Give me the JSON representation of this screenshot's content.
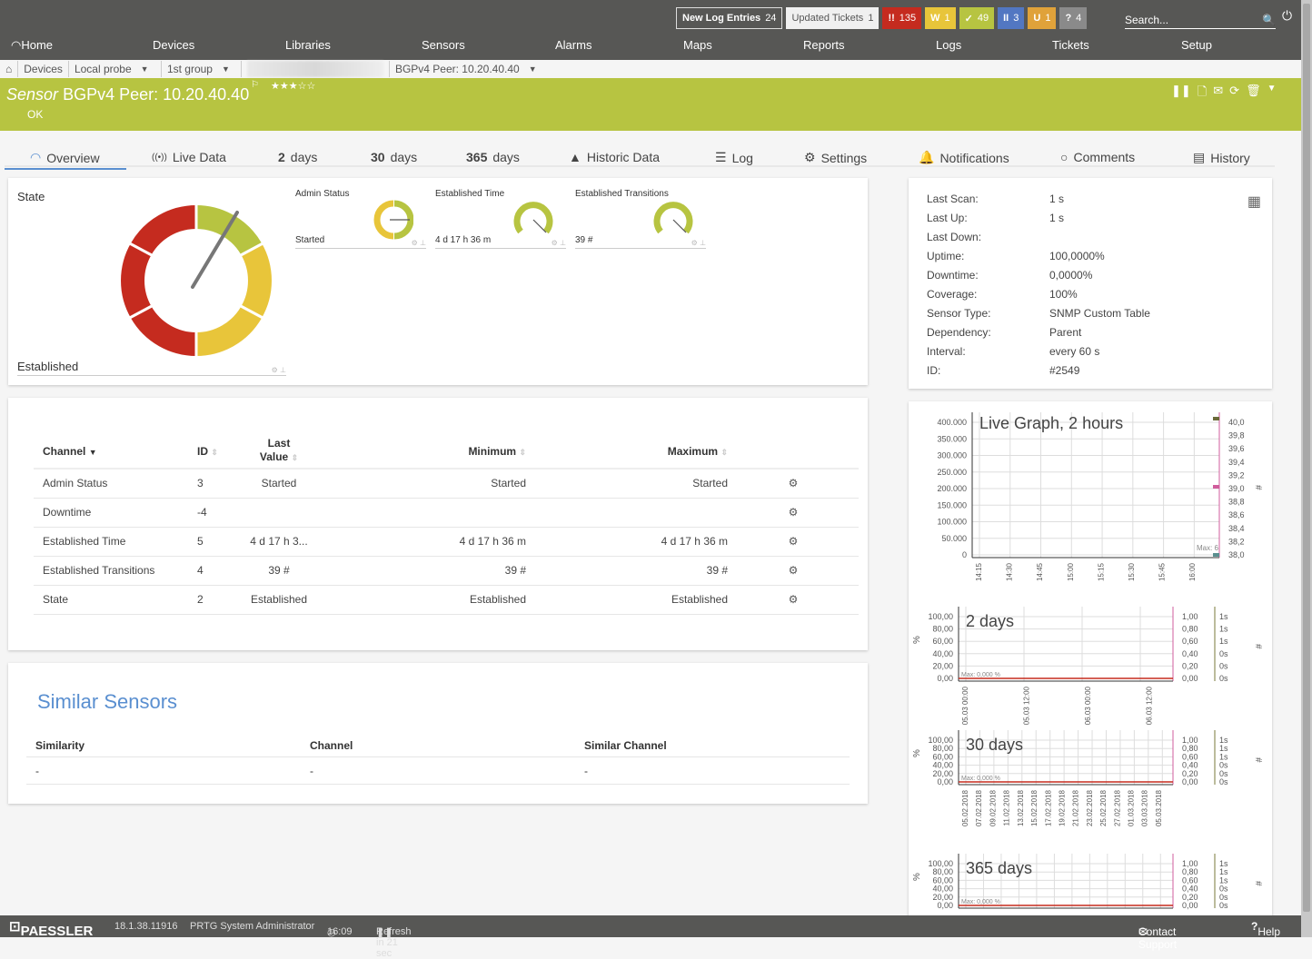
{
  "topbar": {
    "new_log_label": "New Log Entries",
    "new_log_count": "24",
    "updated_tickets_label": "Updated Tickets",
    "updated_tickets_count": "1",
    "status_badges": [
      {
        "icon": "!!",
        "count": "135",
        "color": "#c52b1f",
        "name": "down"
      },
      {
        "icon": "W",
        "count": "1",
        "color": "#e8c53a",
        "name": "warning"
      },
      {
        "icon": "✓",
        "count": "49",
        "color": "#b7c441",
        "name": "up"
      },
      {
        "icon": "II",
        "count": "3",
        "color": "#5277c2",
        "name": "paused"
      },
      {
        "icon": "U",
        "count": "1",
        "color": "#e0a23a",
        "name": "unusual"
      },
      {
        "icon": "?",
        "count": "4",
        "color": "#8a8a8a",
        "name": "unknown"
      }
    ],
    "search_placeholder": "Search..."
  },
  "nav": [
    "Home",
    "Devices",
    "Libraries",
    "Sensors",
    "Alarms",
    "Maps",
    "Reports",
    "Logs",
    "Tickets",
    "Setup"
  ],
  "breadcrumb": [
    "Devices",
    "Local probe",
    "1st group",
    "BGPv4 Peer: 10.20.40.40"
  ],
  "header": {
    "prefix": "Sensor",
    "name": "BGPv4 Peer: 10.20.40.40",
    "status": "OK",
    "stars": "★★★☆☆",
    "color": "#b7c441"
  },
  "tabs": [
    {
      "label": "Overview"
    },
    {
      "label": "Live Data"
    },
    {
      "num": "2",
      "label": "days"
    },
    {
      "num": "30",
      "label": "days"
    },
    {
      "num": "365",
      "label": "days"
    },
    {
      "label": "Historic Data"
    },
    {
      "label": "Log"
    },
    {
      "label": "Settings"
    },
    {
      "label": "Notifications"
    },
    {
      "label": "Comments"
    },
    {
      "label": "History"
    }
  ],
  "state_gauge": {
    "title": "State",
    "value": "Established"
  },
  "small_gauges": [
    {
      "title": "Admin Status",
      "value": "Started"
    },
    {
      "title": "Established Time",
      "value": "4 d 17 h 36 m"
    },
    {
      "title": "Established Transitions",
      "value": "39 #"
    }
  ],
  "info": [
    {
      "k": "Last Scan:",
      "v": "1 s"
    },
    {
      "k": "Last Up:",
      "v": "1 s"
    },
    {
      "k": "Last Down:",
      "v": ""
    },
    {
      "k": "Uptime:",
      "v": "100,0000%"
    },
    {
      "k": "Downtime:",
      "v": "0,0000%"
    },
    {
      "k": "Coverage:",
      "v": "100%"
    },
    {
      "k": "Sensor Type:",
      "v": "SNMP Custom Table"
    },
    {
      "k": "Dependency:",
      "v": "Parent"
    },
    {
      "k": "Interval:",
      "v": "every  60 s"
    },
    {
      "k": "ID:",
      "v": "#2549"
    }
  ],
  "channels": {
    "headers": {
      "channel": "Channel",
      "id": "ID",
      "last1": "Last",
      "last2": "Value",
      "min": "Minimum",
      "max": "Maximum"
    },
    "rows": [
      {
        "channel": "Admin Status",
        "id": "3",
        "last": "Started",
        "min": "Started",
        "max": "Started"
      },
      {
        "channel": "Downtime",
        "id": "-4",
        "last": "",
        "min": "",
        "max": ""
      },
      {
        "channel": "Established Time",
        "id": "5",
        "last": "4 d 17 h 3...",
        "min": "4 d 17 h 36 m",
        "max": "4 d 17 h 36 m"
      },
      {
        "channel": "Established Transitions",
        "id": "4",
        "last": "39 #",
        "min": "39 #",
        "max": "39 #"
      },
      {
        "channel": "State",
        "id": "2",
        "last": "Established",
        "min": "Established",
        "max": "Established"
      }
    ]
  },
  "similar": {
    "title": "Similar Sensors",
    "headers": [
      "Similarity",
      "Channel",
      "Similar Channel"
    ],
    "row": [
      "-",
      "-",
      "-"
    ]
  },
  "chart_data": [
    {
      "type": "line",
      "title": "Live Graph, 2 hours",
      "x": [
        "14:15",
        "14:30",
        "14:45",
        "15:00",
        "15:15",
        "15:30",
        "15:45",
        "16:00"
      ],
      "yticks": [
        "0",
        "50.000",
        "100.000",
        "150.000",
        "200.000",
        "250.000",
        "300.000",
        "350.000",
        "400.000"
      ],
      "y2ticks": [
        "38,0",
        "38,2",
        "38,4",
        "38,6",
        "38,8",
        "39,0",
        "39,2",
        "39,4",
        "39,6",
        "39,8",
        "40,0"
      ],
      "y2label": "#",
      "annotation": "Max: 6",
      "ylim": [
        0,
        400000
      ],
      "y2lim": [
        38,
        40
      ]
    },
    {
      "type": "line",
      "title": "2 days",
      "x": [
        "05.03 00:00",
        "05.03 12:00",
        "06.03 00:00",
        "06.03 12:00"
      ],
      "yticks": [
        "0,00",
        "20,00",
        "40,00",
        "60,00",
        "80,00",
        "100,00"
      ],
      "y2ticks": [
        "0,00",
        "0,20",
        "0,40",
        "0,60",
        "0,80",
        "1,00"
      ],
      "y3ticks": [
        "0s",
        "0s",
        "0s",
        "1s",
        "1s",
        "1s"
      ],
      "ylabel": "%",
      "y2label": "#",
      "annotation": "Max: 0,000 %",
      "ylim": [
        0,
        100
      ],
      "values": [
        0,
        0
      ]
    },
    {
      "type": "line",
      "title": "30 days",
      "x": [
        "05.02.2018",
        "07.02.2018",
        "09.02.2018",
        "11.02.2018",
        "13.02.2018",
        "15.02.2018",
        "17.02.2018",
        "19.02.2018",
        "21.02.2018",
        "23.02.2018",
        "25.02.2018",
        "27.02.2018",
        "01.03.2018",
        "03.03.2018",
        "05.03.2018"
      ],
      "yticks": [
        "0,00",
        "20,00",
        "40,00",
        "60,00",
        "80,00",
        "100,00"
      ],
      "y2ticks": [
        "0,00",
        "0,20",
        "0,40",
        "0,60",
        "0,80",
        "1,00"
      ],
      "y3ticks": [
        "0s",
        "0s",
        "0s",
        "1s",
        "1s",
        "1s"
      ],
      "ylabel": "%",
      "y2label": "#",
      "annotation": "Max: 0,000 %",
      "ylim": [
        0,
        100
      ],
      "values": [
        0,
        0
      ]
    },
    {
      "type": "line",
      "title": "365 days",
      "x": [],
      "yticks": [
        "0,00",
        "20,00",
        "40,00",
        "60,00",
        "80,00",
        "100,00"
      ],
      "y2ticks": [
        "0,00",
        "0,20",
        "0,40",
        "0,60",
        "0,80",
        "1,00"
      ],
      "y3ticks": [
        "0s",
        "0s",
        "0s",
        "1s",
        "1s",
        "1s"
      ],
      "ylabel": "%",
      "y2label": "#",
      "annotation": "Max: 0,000 %",
      "ylim": [
        0,
        100
      ],
      "values": [
        0,
        0
      ]
    }
  ],
  "footer": {
    "brand": "PAESSLER",
    "version": "18.1.38.11916",
    "user": "PRTG System Administrator",
    "time": "16:09",
    "refresh": "Refresh in 21 sec",
    "contact": "Contact Support",
    "help": "Help"
  }
}
